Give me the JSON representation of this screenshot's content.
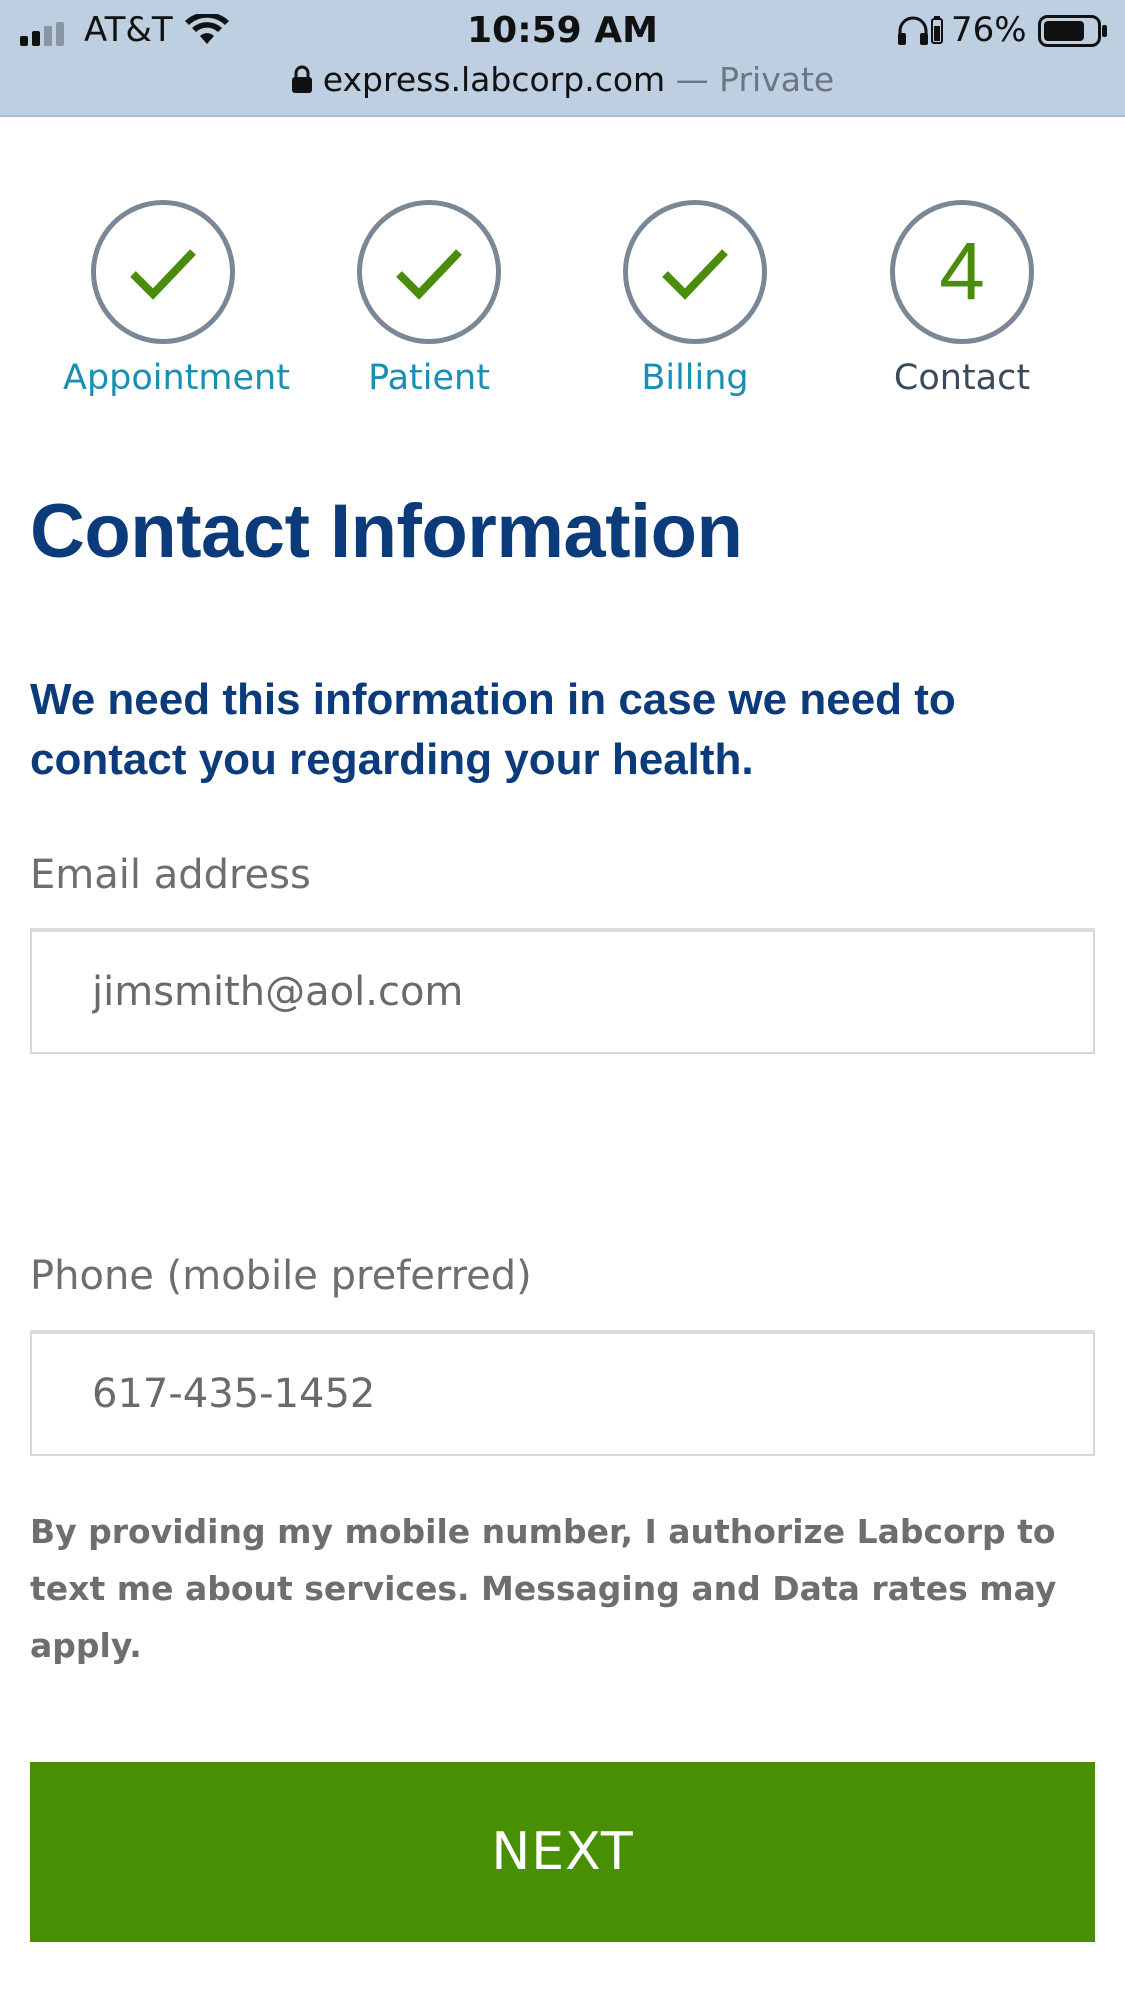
{
  "status_bar": {
    "carrier": "AT&T",
    "time": "10:59 AM",
    "battery_percent": "76%",
    "battery_level": 0.76
  },
  "browser": {
    "url": "express.labcorp.com",
    "mode": " — Private"
  },
  "stepper": {
    "steps": [
      {
        "label": "Appointment",
        "state": "complete"
      },
      {
        "label": "Patient",
        "state": "complete"
      },
      {
        "label": "Billing",
        "state": "complete"
      },
      {
        "label": "Contact",
        "state": "current",
        "number": "4"
      }
    ]
  },
  "main": {
    "title": "Contact Information",
    "intro": "We need this information in case we need to contact you regarding your health.",
    "email": {
      "label": "Email address",
      "value": "jimsmith@aol.com"
    },
    "phone": {
      "label": "Phone (mobile preferred)",
      "value": "617-435-1452"
    },
    "disclaimer": "By providing my mobile number, I authorize Labcorp to text me about services. Messaging and Data rates may apply.",
    "next_label": "NEXT"
  },
  "colors": {
    "brand_blue": "#0b3b7a",
    "step_link": "#1a8fb4",
    "accent_green": "#488f04",
    "check_green": "#4a8c0c",
    "circle_gray": "#7a8796",
    "browser_bar": "#bdcfe0"
  },
  "icons": [
    "signal-icon",
    "wifi-icon",
    "headphones-icon",
    "battery-icon",
    "lock-icon",
    "checkmark-icon"
  ]
}
